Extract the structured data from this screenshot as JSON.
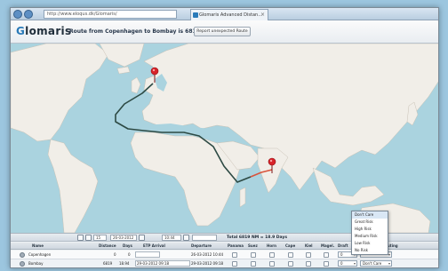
{
  "browser": {
    "address": "http://www.eloqus.dk/Glomaris/",
    "tab_title": "Glomaris Advanced Distan..."
  },
  "header": {
    "logo_first": "G",
    "logo_rest": "lomaris",
    "route_title": "Route from Copenhagen to Bombay is 6819 NM",
    "report_button": "Report unexpected Route"
  },
  "toolbar": {
    "speed": "15",
    "date": "26-03-2012",
    "time": "10:44",
    "total": "Total 6819 NM = 18.9 Days"
  },
  "table": {
    "columns": [
      "Name",
      "Distance",
      "Days",
      "ETP Arrival",
      "Departure",
      "Panama",
      "Suez",
      "Horn",
      "Cape",
      "Kiel",
      "Magel.",
      "Draft",
      "Routing"
    ],
    "rows": [
      {
        "name": "Copenhagen",
        "distance": "0",
        "days": "0",
        "etp": "",
        "departure": "26-03-2012 10:44",
        "draft": "0",
        "routing": ""
      },
      {
        "name": "Bombay",
        "distance": "6819",
        "days": "18.94",
        "etp": "29-03-2012 09:18",
        "departure": "29-03-2012 09:18",
        "draft": "0",
        "routing": "Don't Care"
      }
    ]
  },
  "routing_dropdown": {
    "options": [
      "Don't Care",
      "Great Risk",
      "High Risk",
      "Medium Risk",
      "Low Risk",
      "No Risk"
    ],
    "selected_index": 0
  },
  "map": {
    "land_color": "#f1eee8",
    "sea_color": "#aad3df",
    "route_main_color": "#2d4a44",
    "route_last_leg_color": "#d9543c",
    "pin_color": "#d8232a"
  }
}
